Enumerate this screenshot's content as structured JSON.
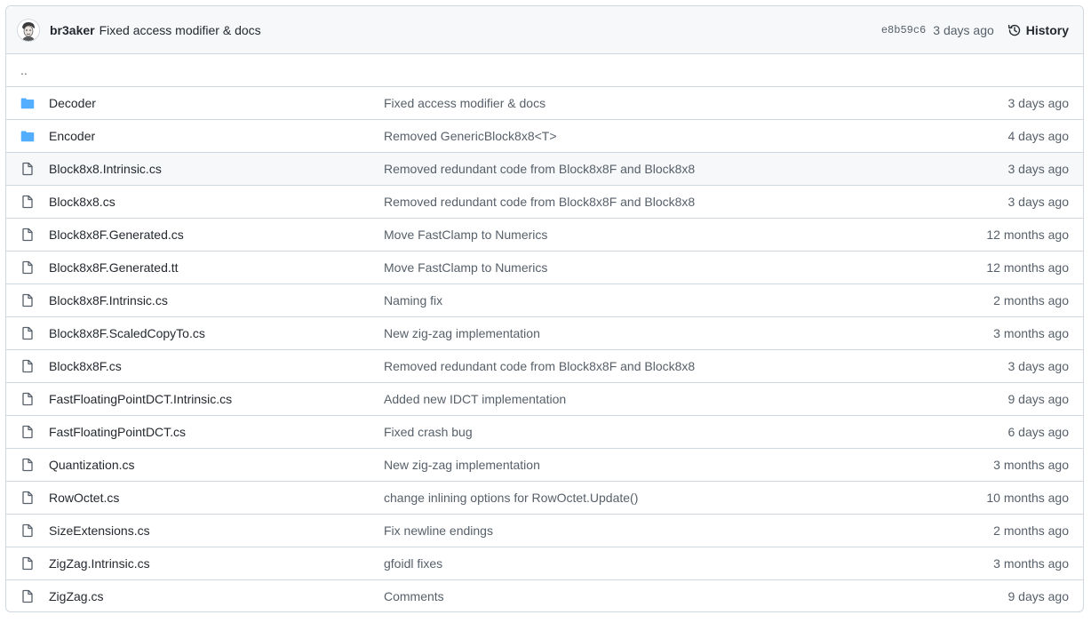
{
  "latest_commit": {
    "author": "br3aker",
    "message": "Fixed access modifier & docs",
    "sha": "e8b59c6",
    "age": "3 days ago",
    "history_label": "History"
  },
  "parent_dir_label": "..",
  "colors": {
    "folder": "#54aeff",
    "file": "#57606a",
    "border": "#d0d7de",
    "header_bg": "#f6f8fa"
  },
  "entries": [
    {
      "type": "folder",
      "icon": "folder-icon",
      "name": "Decoder",
      "message": "Fixed access modifier & docs",
      "age": "3 days ago"
    },
    {
      "type": "folder",
      "icon": "folder-icon",
      "name": "Encoder",
      "message": "Removed GenericBlock8x8<T>",
      "age": "4 days ago"
    },
    {
      "type": "file",
      "icon": "file-icon",
      "name": "Block8x8.Intrinsic.cs",
      "message": "Removed redundant code from Block8x8F and Block8x8",
      "age": "3 days ago",
      "highlight": true
    },
    {
      "type": "file",
      "icon": "file-icon",
      "name": "Block8x8.cs",
      "message": "Removed redundant code from Block8x8F and Block8x8",
      "age": "3 days ago"
    },
    {
      "type": "file",
      "icon": "file-icon",
      "name": "Block8x8F.Generated.cs",
      "message": "Move FastClamp to Numerics",
      "age": "12 months ago"
    },
    {
      "type": "file",
      "icon": "file-icon",
      "name": "Block8x8F.Generated.tt",
      "message": "Move FastClamp to Numerics",
      "age": "12 months ago"
    },
    {
      "type": "file",
      "icon": "file-icon",
      "name": "Block8x8F.Intrinsic.cs",
      "message": "Naming fix",
      "age": "2 months ago"
    },
    {
      "type": "file",
      "icon": "file-icon",
      "name": "Block8x8F.ScaledCopyTo.cs",
      "message": "New zig-zag implementation",
      "age": "3 months ago"
    },
    {
      "type": "file",
      "icon": "file-icon",
      "name": "Block8x8F.cs",
      "message": "Removed redundant code from Block8x8F and Block8x8",
      "age": "3 days ago"
    },
    {
      "type": "file",
      "icon": "file-icon",
      "name": "FastFloatingPointDCT.Intrinsic.cs",
      "message": "Added new IDCT implementation",
      "age": "9 days ago"
    },
    {
      "type": "file",
      "icon": "file-icon",
      "name": "FastFloatingPointDCT.cs",
      "message": "Fixed crash bug",
      "age": "6 days ago"
    },
    {
      "type": "file",
      "icon": "file-icon",
      "name": "Quantization.cs",
      "message": "New zig-zag implementation",
      "age": "3 months ago"
    },
    {
      "type": "file",
      "icon": "file-icon",
      "name": "RowOctet.cs",
      "message": "change inlining options for RowOctet.Update()",
      "age": "10 months ago"
    },
    {
      "type": "file",
      "icon": "file-icon",
      "name": "SizeExtensions.cs",
      "message": "Fix newline endings",
      "age": "2 months ago"
    },
    {
      "type": "file",
      "icon": "file-icon",
      "name": "ZigZag.Intrinsic.cs",
      "message": "gfoidl fixes",
      "age": "3 months ago"
    },
    {
      "type": "file",
      "icon": "file-icon",
      "name": "ZigZag.cs",
      "message": "Comments",
      "age": "9 days ago"
    }
  ]
}
